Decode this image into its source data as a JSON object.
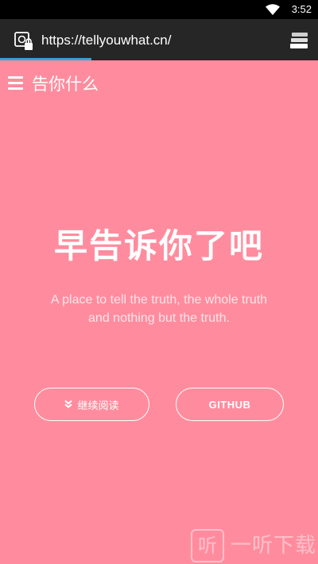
{
  "status_bar": {
    "time": "3:52",
    "wifi_icon": "wifi-icon"
  },
  "browser": {
    "url": "https://tellyouwhat.cn/",
    "site_icon": "secure-site-icon",
    "tabs_icon": "tabs-stack-icon",
    "progress_color": "#35a1d6",
    "toolbar_color": "#262626"
  },
  "page": {
    "background_color": "#ff8c9e",
    "menu_icon": "hamburger-menu-icon",
    "site_title": "告你什么",
    "hero_title": "早告诉你了吧",
    "hero_subtitle": "A place to tell the truth, the whole truth and nothing but the truth.",
    "buttons": {
      "read_more_icon": "double-chevron-down-icon",
      "read_more_label": "继续阅读",
      "github_label": "GITHUB"
    }
  },
  "watermark": {
    "logo_glyph": "听",
    "text": "一听下载"
  }
}
